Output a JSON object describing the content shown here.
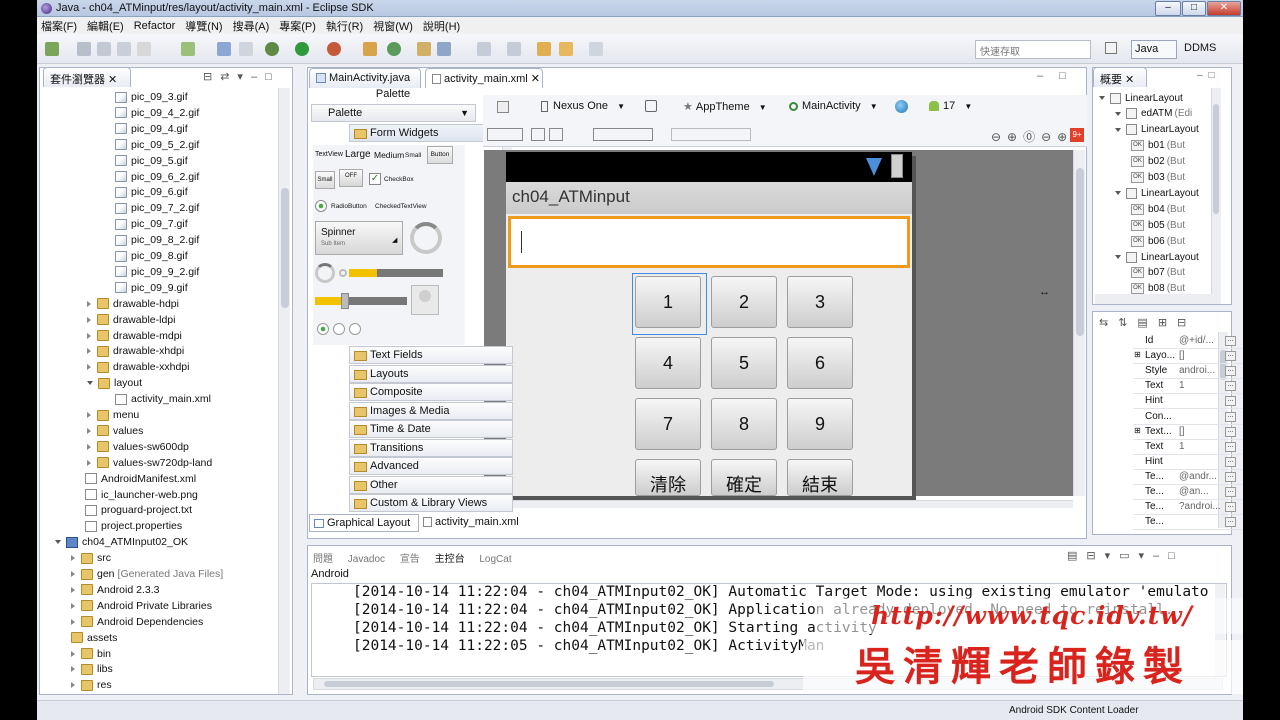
{
  "window": {
    "title": "Java - ch04_ATMinput/res/layout/activity_main.xml - Eclipse SDK",
    "controls": [
      "–",
      "□",
      "✕"
    ]
  },
  "menu": [
    "檔案(F)",
    "編輯(E)",
    "Refactor",
    "導覽(N)",
    "搜尋(A)",
    "專案(P)",
    "執行(R)",
    "視窗(W)",
    "說明(H)"
  ],
  "toolbar": {
    "quick_access_placeholder": "快速存取",
    "perspectives": [
      "Java",
      "DDMS"
    ]
  },
  "explorer": {
    "tab": "套件瀏覽器",
    "files": [
      "pic_09_3.gif",
      "pic_09_4_2.gif",
      "pic_09_4.gif",
      "pic_09_5_2.gif",
      "pic_09_5.gif",
      "pic_09_6_2.gif",
      "pic_09_6.gif",
      "pic_09_7_2.gif",
      "pic_09_7.gif",
      "pic_09_8_2.gif",
      "pic_09_8.gif",
      "pic_09_9_2.gif",
      "pic_09_9.gif"
    ],
    "folders1": [
      "drawable-hdpi",
      "drawable-ldpi",
      "drawable-mdpi",
      "drawable-xhdpi",
      "drawable-xxhdpi"
    ],
    "layout": "layout",
    "layout_file": "activity_main.xml",
    "folders2": [
      "menu",
      "values",
      "values-sw600dp",
      "values-sw720dp-land"
    ],
    "root_files": [
      "AndroidManifest.xml",
      "ic_launcher-web.png",
      "proguard-project.txt",
      "project.properties"
    ],
    "project2": "ch04_ATMInput02_OK",
    "p2_src": "src",
    "p2_gen": "gen",
    "p2_gen_note": "[Generated Java Files]",
    "p2_items": [
      "Android 2.3.3",
      "Android Private Libraries",
      "Android Dependencies",
      "assets",
      "bin",
      "libs",
      "res"
    ]
  },
  "editor": {
    "tabs": [
      "MainActivity.java",
      "activity_main.xml"
    ],
    "bottom_tabs": [
      "Graphical Layout",
      "activity_main.xml"
    ],
    "config": {
      "device": "Nexus One",
      "theme": "AppTheme",
      "activity": "MainActivity",
      "api": "17"
    }
  },
  "palette": {
    "title": "Palette",
    "selector": "Palette",
    "section": "Form Widgets",
    "widgets": {
      "textview": "TextView",
      "large": "Large",
      "medium": "Medium",
      "small": "Small",
      "button": "Button",
      "small_btn": "Small",
      "off": "OFF",
      "checkbox": "CheckBox",
      "radio": "RadioButton",
      "checked": "CheckedTextView",
      "spinner": "Spinner",
      "sub": "Sub Item"
    },
    "categories": [
      "Text Fields",
      "Layouts",
      "Composite",
      "Images & Media",
      "Time & Date",
      "Transitions",
      "Advanced",
      "Other",
      "Custom & Library Views"
    ]
  },
  "device": {
    "app_title": "ch04_ATMinput",
    "buttons": [
      "1",
      "2",
      "3",
      "4",
      "5",
      "6",
      "7",
      "8",
      "9",
      "清除",
      "確定",
      "結束"
    ]
  },
  "outline": {
    "tab": "概要",
    "items": [
      {
        "label": "LinearLayout",
        "level": 0
      },
      {
        "label": "edATM",
        "note": "(Edi",
        "level": 1
      },
      {
        "label": "LinearLayout",
        "level": 1
      },
      {
        "label": "b01",
        "note": "(But",
        "level": 2
      },
      {
        "label": "b02",
        "note": "(But",
        "level": 2
      },
      {
        "label": "b03",
        "note": "(But",
        "level": 2
      },
      {
        "label": "LinearLayout",
        "level": 1
      },
      {
        "label": "b04",
        "note": "(But",
        "level": 2
      },
      {
        "label": "b05",
        "note": "(But",
        "level": 2
      },
      {
        "label": "b06",
        "note": "(But",
        "level": 2
      },
      {
        "label": "LinearLayout",
        "level": 1
      },
      {
        "label": "b07",
        "note": "(But",
        "level": 2
      },
      {
        "label": "b08",
        "note": "(But",
        "level": 2
      }
    ]
  },
  "properties": [
    {
      "k": "Id",
      "v": "@+id/..."
    },
    {
      "k": "Layo...",
      "v": "[]"
    },
    {
      "k": "Style",
      "v": "androi..."
    },
    {
      "k": "Text",
      "v": "1"
    },
    {
      "k": "Hint",
      "v": ""
    },
    {
      "k": "Con...",
      "v": ""
    },
    {
      "k": "Text...",
      "v": "[]"
    },
    {
      "k": "Text",
      "v": "1"
    },
    {
      "k": "Hint",
      "v": ""
    },
    {
      "k": "Te...",
      "v": "@andr..."
    },
    {
      "k": "Te...",
      "v": "@an..."
    },
    {
      "k": "Te...",
      "v": "?androi..."
    },
    {
      "k": "Te...",
      "v": ""
    }
  ],
  "console": {
    "tabs": [
      "問題",
      "Javadoc",
      "宣告",
      "主控台",
      "LogCat"
    ],
    "label": "Android",
    "lines": [
      "[2014-10-14 11:22:04 - ch04_ATMInput02_OK] Automatic Target Mode: using existing emulator 'emulato",
      "[2014-10-14 11:22:04 - ch04_ATMInput02_OK] Application already deployed. No need to reinstall.",
      "[2014-10-14 11:22:04 - ch04_ATMInput02_OK] Starting activity",
      "[2014-10-14 11:22:05 - ch04_ATMInput02_OK] ActivityMan"
    ]
  },
  "watermark": {
    "url": "http://www.tqc.idv.tw/",
    "name": "吳清輝老師錄製"
  },
  "status": {
    "text": "Android SDK Content Loader"
  }
}
